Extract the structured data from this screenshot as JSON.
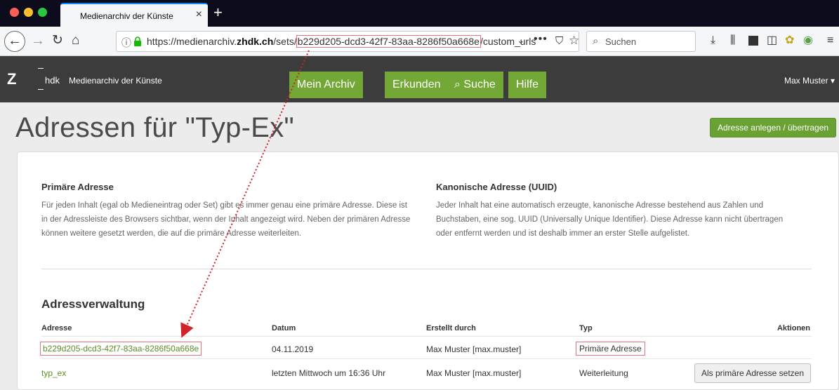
{
  "browser": {
    "tab_title": "Medienarchiv der Künste",
    "tab_close": "×",
    "new_tab": "+",
    "url_prefix": "https://medienarchiv.",
    "url_domain": "zhdk.ch",
    "url_path": "/sets/",
    "url_uuid": "b229d205-dcd3-42f7-83aa-8286f50a668e",
    "url_suffix": "/custom_urls",
    "search_placeholder": "Suchen"
  },
  "header": {
    "logo": "Z",
    "logo_sub": "hdk",
    "site_title": "Medienarchiv der Künste",
    "nav": [
      "Mein Archiv",
      "Erkunden",
      "Suche",
      "Hilfe"
    ],
    "user": "Max Muster ▾"
  },
  "page": {
    "title": "Adressen für \"Typ-Ex\"",
    "create_button": "Adresse anlegen / übertragen"
  },
  "info": {
    "primary": {
      "heading": "Primäre Adresse",
      "text": "Für jeden Inhalt (egal ob Medieneintrag oder Set) gibt es immer genau eine primäre Adresse. Diese ist in der Adressleiste des Browsers sichtbar, wenn der Inhalt angezeigt wird. Neben der primären Adresse können weitere gesetzt werden, die auf die primäre Adresse weiterleiten."
    },
    "canonical": {
      "heading": "Kanonische Adresse (UUID)",
      "text": "Jeder Inhalt hat eine automatisch erzeugte, kanonische Adresse bestehend aus Zahlen und Buchstaben, eine sog. UUID (Universally Unique Identifier). Diese Adresse kann nicht übertragen oder entfernt werden und ist deshalb immer an erster Stelle aufgelistet."
    }
  },
  "table": {
    "heading": "Adressverwaltung",
    "columns": [
      "Adresse",
      "Datum",
      "Erstellt durch",
      "Typ",
      "Aktionen"
    ],
    "rows": [
      {
        "address": "b229d205-dcd3-42f7-83aa-8286f50a668e",
        "date": "04.11.2019",
        "creator": "Max Muster [max.muster]",
        "type": "Primäre Adresse",
        "action": ""
      },
      {
        "address": "typ_ex",
        "date": "letzten Mittwoch um 16:36 Uhr",
        "creator": "Max Muster [max.muster]",
        "type": "Weiterleitung",
        "action": "Als primäre Adresse setzen"
      }
    ]
  },
  "colors": {
    "accent_green": "#74a836",
    "link_green": "#5d8d25",
    "highlight_red": "#e7727d",
    "arrow_red": "#d0232a"
  }
}
